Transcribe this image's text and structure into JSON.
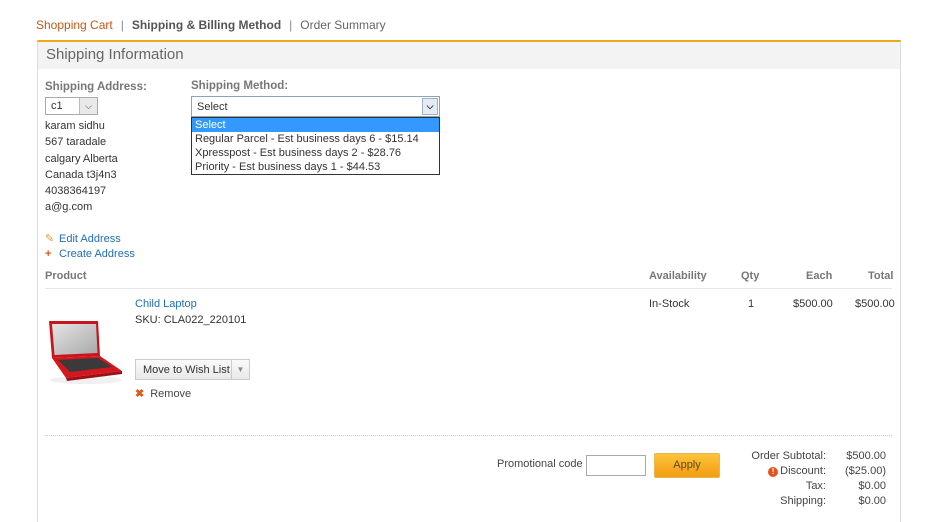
{
  "breadcrumb": {
    "items": [
      "Shopping Cart",
      "Shipping & Billing Method",
      "Order Summary"
    ],
    "separator": "|"
  },
  "panel": {
    "title": "Shipping Information",
    "accent_color": "#f0a818"
  },
  "shipping_address": {
    "label": "Shipping Address:",
    "selected": "c1",
    "lines": [
      "karam sidhu",
      "567 taradale",
      "calgary Alberta",
      "Canada t3j4n3",
      "4038364197",
      "a@g.com"
    ],
    "edit_label": "Edit Address",
    "create_label": "Create Address"
  },
  "shipping_method": {
    "label": "Shipping Method:",
    "selected": "Select",
    "options": [
      "Select",
      "Regular Parcel - Est business days 6 - $15.14",
      "Xpresspost - Est business days 2 - $28.76",
      "Priority - Est business days 1 - $44.53"
    ],
    "highlighted_index": 0
  },
  "table": {
    "headers": [
      "Product",
      "Availability",
      "Qty",
      "Each",
      "Total"
    ],
    "rows": [
      {
        "name": "Child Laptop",
        "sku": "SKU: CLA022_220101",
        "availability": "In-Stock",
        "qty": "1",
        "each": "$500.00",
        "total": "$500.00",
        "wish_label": "Move to Wish List",
        "remove_label": "Remove"
      }
    ]
  },
  "promo": {
    "label": "Promotional code",
    "value": "",
    "apply_label": "Apply"
  },
  "totals": [
    {
      "label": "Order Subtotal:",
      "value": "$500.00"
    },
    {
      "label": "Discount:",
      "value": "($25.00)"
    },
    {
      "label": "Tax:",
      "value": "$0.00"
    },
    {
      "label": "Shipping:",
      "value": "$0.00"
    }
  ]
}
